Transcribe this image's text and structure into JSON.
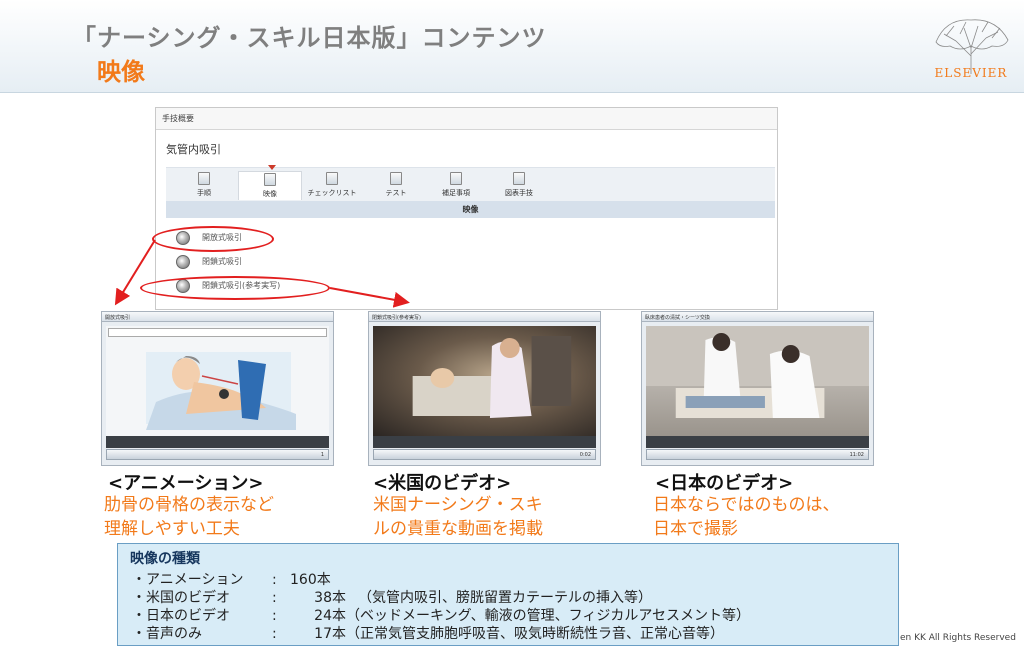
{
  "header": {
    "title": "「ナーシング・スキル日本版」コンテンツ",
    "subtitle": "映像",
    "logo_text": "ELSEVIER"
  },
  "screenshot": {
    "header_label": "手技概要",
    "procedure_title": "気管内吸引",
    "tabs": [
      {
        "label": "手順",
        "icon": "document-icon"
      },
      {
        "label": "映像",
        "icon": "video-icon",
        "active": true
      },
      {
        "label": "チェックリスト",
        "icon": "checklist-icon"
      },
      {
        "label": "テスト",
        "icon": "test-icon"
      },
      {
        "label": "補足事項",
        "icon": "notes-icon"
      },
      {
        "label": "図表手技",
        "icon": "figure-icon"
      }
    ],
    "section_label": "映像",
    "video_items": [
      {
        "label": "開放式吸引",
        "icon": "play-icon"
      },
      {
        "label": "閉鎖式吸引",
        "icon": "play-icon"
      },
      {
        "label": "閉鎖式吸引(参考実写)",
        "icon": "play-icon"
      }
    ]
  },
  "thumbnails": [
    {
      "header": "開放式吸引",
      "caption": "",
      "counter": "1",
      "label": "<アニメーション>",
      "description_line1": "肋骨の骨格の表示など",
      "description_line2": "理解しやすい工夫"
    },
    {
      "header": "閉鎖式吸引(参考実写)",
      "caption": "",
      "counter": "0:02",
      "label": "<米国のビデオ>",
      "description_line1": "米国ナーシング・スキ",
      "description_line2": "ルの貴重な動画を掲載"
    },
    {
      "header": "臥床患者の清拭・シーツ交換",
      "caption": "",
      "counter": "11:02",
      "label": "<日本のビデオ>",
      "description_line1": "日本ならではのものは、",
      "description_line2": "日本で撮影"
    }
  ],
  "info_box": {
    "title": "映像の種類",
    "rows": [
      {
        "name": "・アニメーション",
        "sep": ":",
        "count": "160本",
        "note": ""
      },
      {
        "name": "・米国のビデオ",
        "sep": ":",
        "count": "38本",
        "note": "（気管内吸引、膀胱留置カテーテルの挿入等）"
      },
      {
        "name": "・日本のビデオ",
        "sep": ":",
        "count": "24本",
        "note": "（ベッドメーキング、輸液の管理、フィジカルアセスメント等）"
      },
      {
        "name": "・音声のみ",
        "sep": ":",
        "count": "17本",
        "note": "（正常気管支肺胞呼吸音、吸気時断続性ラ音、正常心音等）"
      }
    ]
  },
  "footer": {
    "copyright": "en KK All Rights Reserved"
  },
  "colors": {
    "accent": "#f27a1a",
    "ellipse_red": "#e21f1f",
    "info_bg": "#d8ecf7"
  }
}
